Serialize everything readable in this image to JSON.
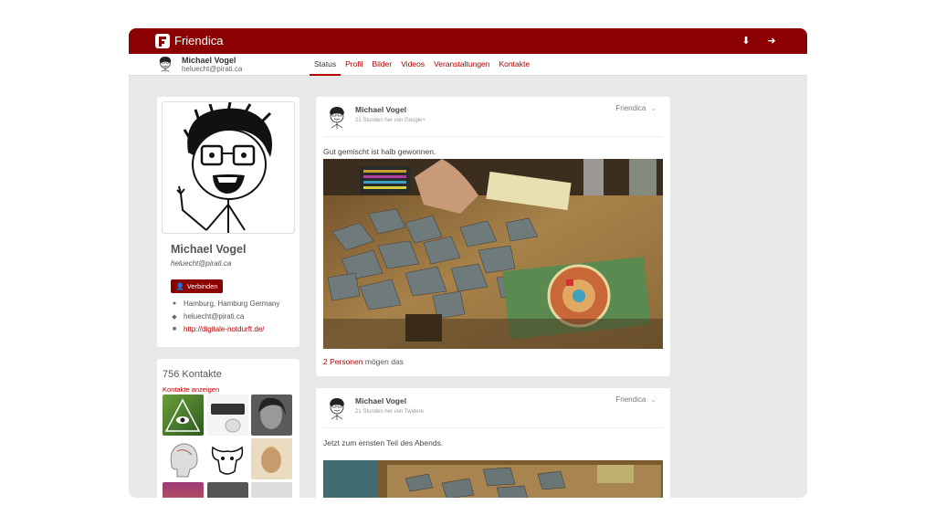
{
  "app": {
    "title": "Friendica",
    "brand_color": "#8b0000",
    "download_icon": "download-icon",
    "login_icon": "login-icon"
  },
  "subnav": {
    "name": "Michael Vogel",
    "handle": "heluecht@pirati.ca",
    "tabs": [
      {
        "label": "Status",
        "active": true
      },
      {
        "label": "Profil",
        "active": false
      },
      {
        "label": "Bilder",
        "active": false
      },
      {
        "label": "Videos",
        "active": false
      },
      {
        "label": "Veranstaltungen",
        "active": false
      },
      {
        "label": "Kontakte",
        "active": false
      }
    ]
  },
  "profile": {
    "name": "Michael Vogel",
    "handle": "heluecht@pirati.ca",
    "connect_label": "Verbinden",
    "location": "Hamburg, Hamburg Germany",
    "chat": "heluecht@pirati.ca",
    "homepage": "http://digitale-notdurft.de/"
  },
  "contacts": {
    "count_label": "756 Kontakte",
    "show_label": "Kontakte anzeigen"
  },
  "posts": [
    {
      "author": "Michael Vogel",
      "meta": "21 Stunden her von Google+",
      "network": "Friendica",
      "text": "Gut gemischt ist halb gewonnen.",
      "likes_count": "2 Personen",
      "likes_suffix": "mögen das"
    },
    {
      "author": "Michael Vogel",
      "meta": "21 Stunden her von Twidere",
      "network": "Friendica",
      "text": "Jetzt zum ernsten Teil des Abends."
    }
  ]
}
